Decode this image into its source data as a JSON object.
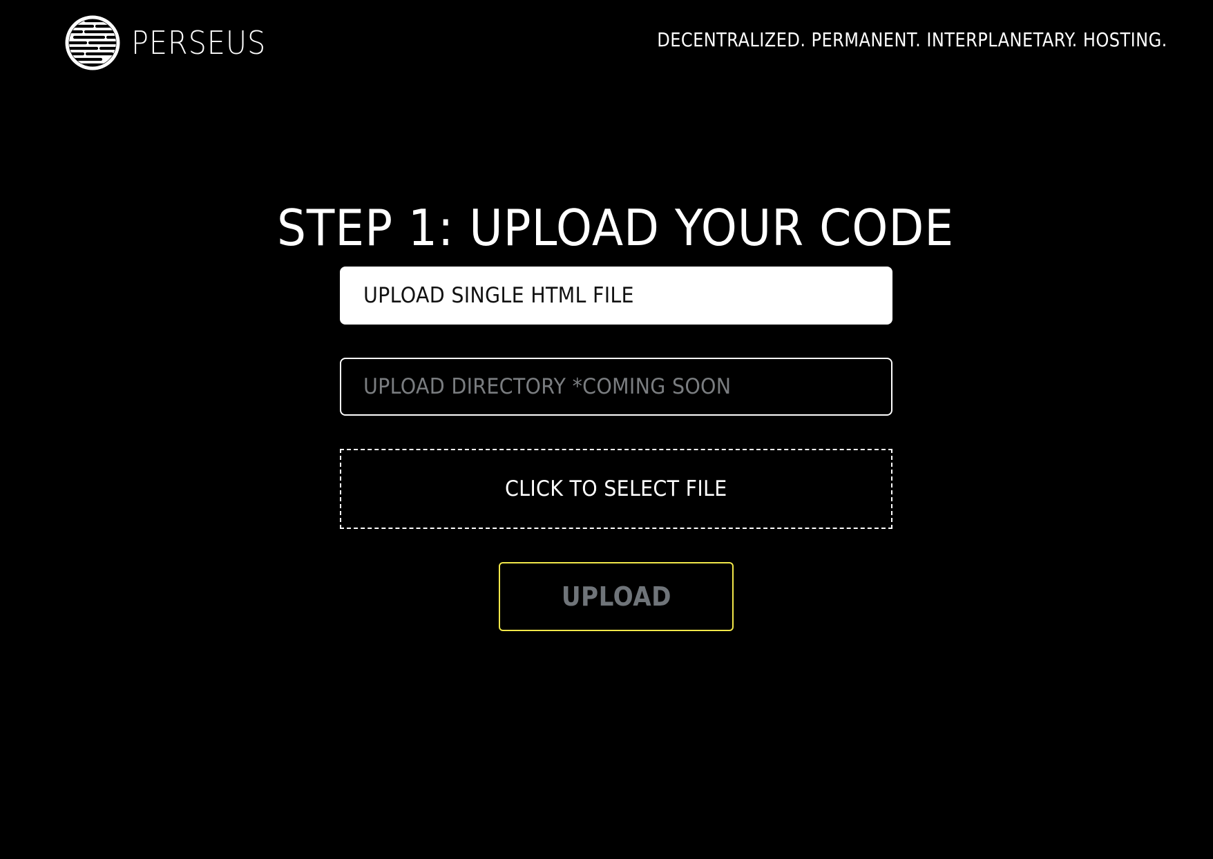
{
  "header": {
    "brand_name": "PERSEUS",
    "logo_icon": "perseus-striped-globe-icon",
    "tagline": "DECENTRALIZED. PERMANENT. INTERPLANETARY. HOSTING."
  },
  "main": {
    "title": "STEP 1: UPLOAD YOUR CODE",
    "options": [
      {
        "label": "UPLOAD SINGLE HTML FILE",
        "state": "selected"
      },
      {
        "label": "UPLOAD DIRECTORY *COMING SOON",
        "state": "disabled"
      }
    ],
    "dropzone": {
      "label": "CLICK TO SELECT FILE"
    },
    "upload_button": {
      "label": "UPLOAD",
      "state": "disabled"
    }
  },
  "colors": {
    "background": "#000000",
    "text": "#ffffff",
    "muted_text": "#7a7d80",
    "accent": "#f2e84a"
  }
}
